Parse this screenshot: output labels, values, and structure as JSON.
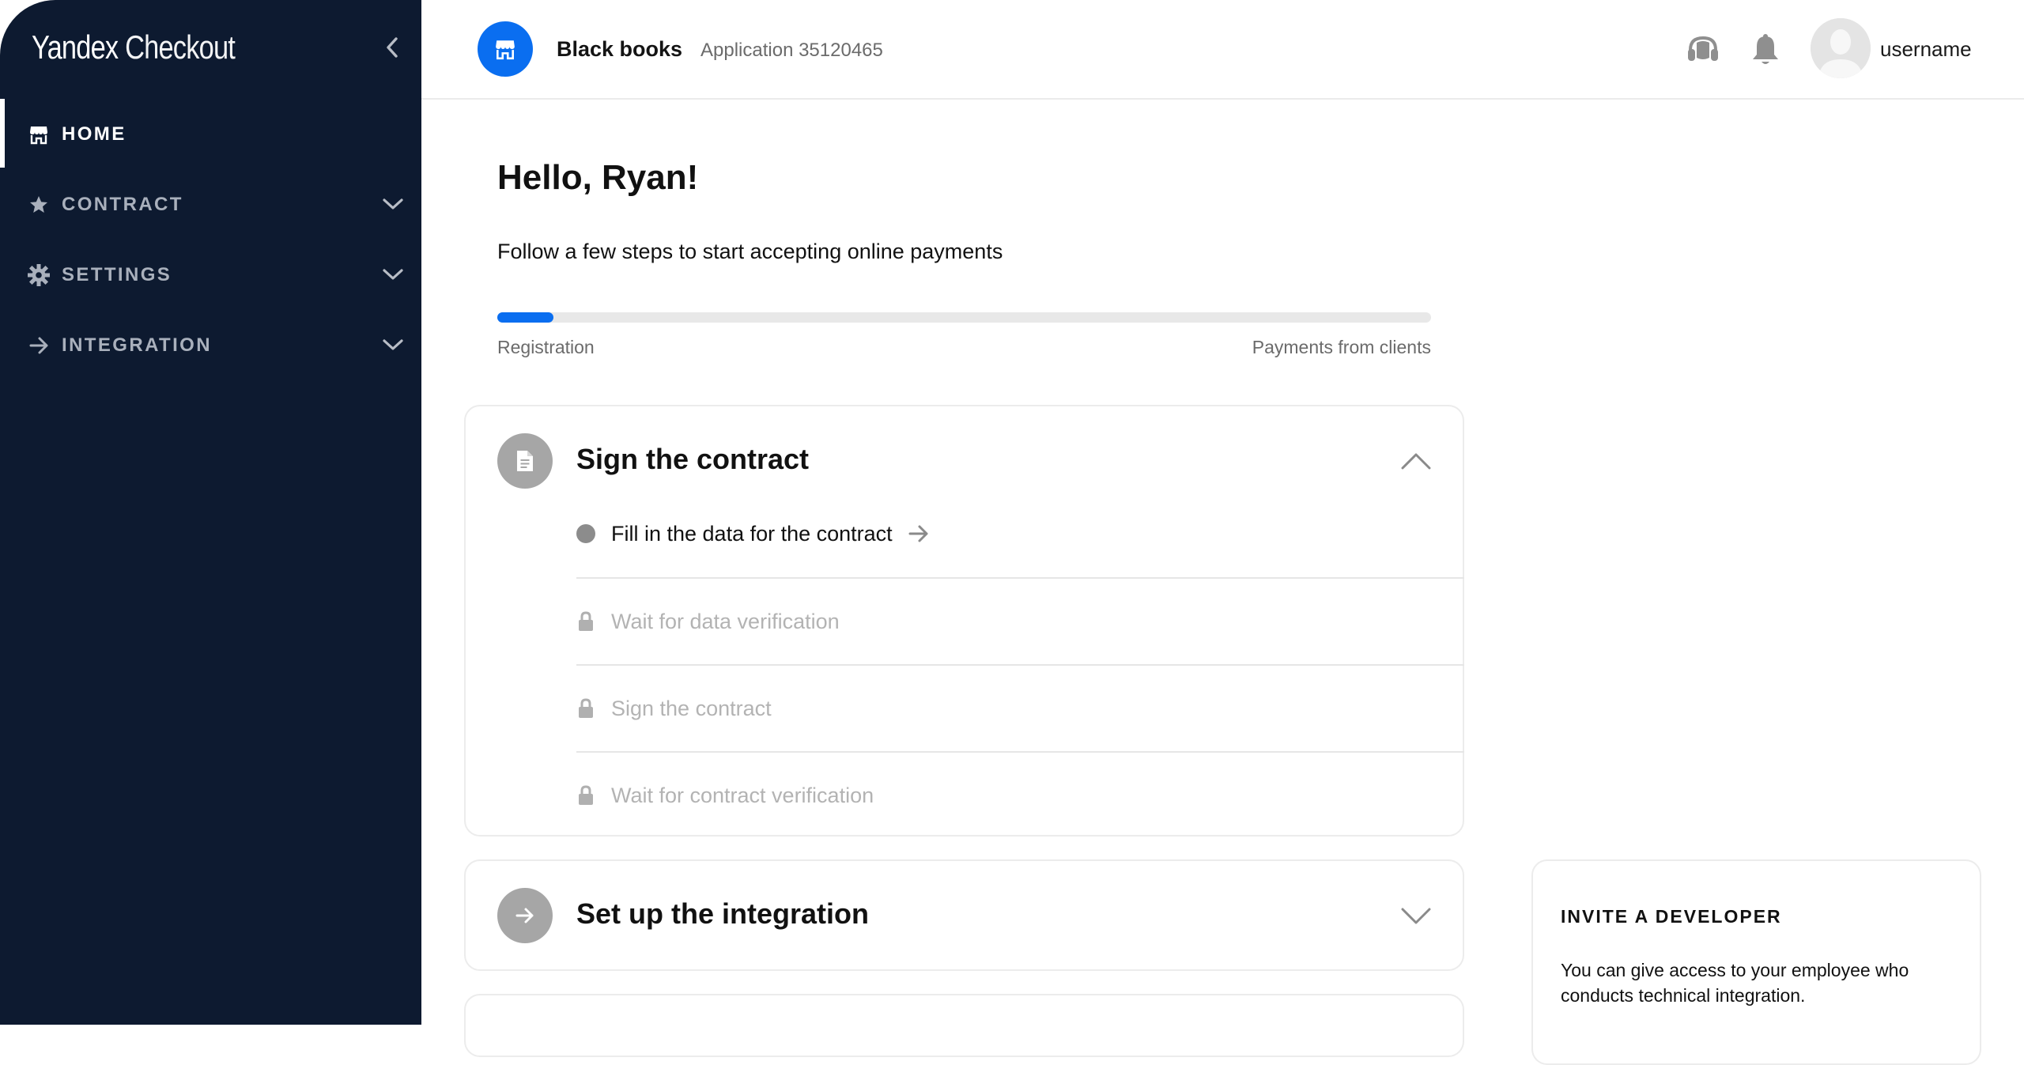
{
  "sidebar": {
    "brand": {
      "word1": "Yandex",
      "word2": "Checkout"
    },
    "collapse_icon": "chevron-left-icon",
    "items": [
      {
        "label": "HOME",
        "icon": "store-icon",
        "active": true
      },
      {
        "label": "CONTRACT",
        "icon": "star-icon",
        "active": false
      },
      {
        "label": "SETTINGS",
        "icon": "gear-icon",
        "active": false
      },
      {
        "label": "INTEGRATION",
        "icon": "arrow-right-icon",
        "active": false
      }
    ]
  },
  "header": {
    "shop_name": "Black books",
    "application": "Application 35120465",
    "icons": [
      "headset-icon",
      "bell-icon"
    ],
    "username": "username"
  },
  "main": {
    "greeting": "Hello, Ryan!",
    "subtitle": "Follow a few steps to start accepting online payments",
    "progress": {
      "value_percent": 6,
      "start_label": "Registration",
      "end_label": "Payments from clients"
    },
    "steps": [
      {
        "title": "Sign the contract",
        "icon": "document-icon",
        "expanded": true,
        "substeps": [
          {
            "label": "Fill in the data for the contract",
            "state": "active"
          },
          {
            "label": "Wait for data verification",
            "state": "locked"
          },
          {
            "label": "Sign the contract",
            "state": "locked"
          },
          {
            "label": "Wait for contract verification",
            "state": "locked"
          }
        ]
      },
      {
        "title": "Set up the integration",
        "icon": "arrow-right-icon",
        "expanded": false
      }
    ]
  },
  "invite": {
    "title": "INVITE A DEVELOPER",
    "text": "You can give access to your employee who conducts technical integration."
  },
  "colors": {
    "sidebar_bg": "#0d1a30",
    "accent": "#0a6ef0",
    "badge_gray": "#a6a6a6"
  }
}
